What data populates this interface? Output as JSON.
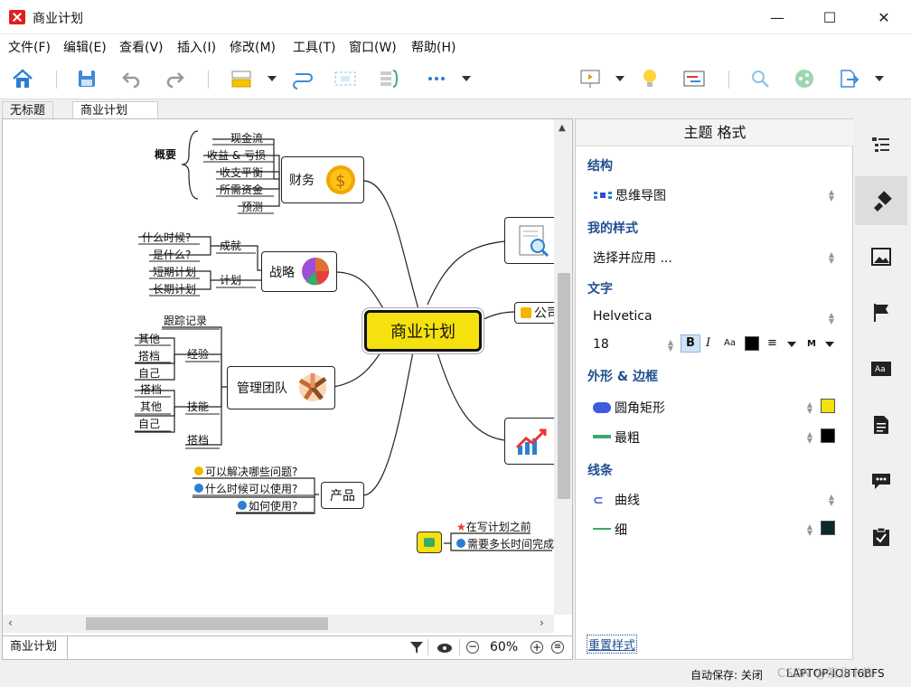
{
  "window": {
    "title": "商业计划",
    "minimize": "—",
    "maximize": "☐",
    "close": "✕"
  },
  "menu": [
    "文件(F)",
    "编辑(E)",
    "查看(V)",
    "插入(I)",
    "修改(M)",
    "工具(T)",
    "窗口(W)",
    "帮助(H)"
  ],
  "toolbar": {
    "icons": [
      "home-icon",
      "save-icon",
      "undo-icon",
      "redo-icon",
      "topic-icon",
      "relationship-icon",
      "boundary-icon",
      "summary-icon",
      "more-icon",
      "presentation-icon",
      "brainstorm-icon",
      "gantt-icon",
      "search-icon",
      "share-icon",
      "export-icon"
    ]
  },
  "tabs": [
    "无标题",
    "商业计划"
  ],
  "map": {
    "central": "商业计划",
    "finance": {
      "label": "财务",
      "summary": "概要",
      "items": [
        "现金流",
        "收益 & 亏损",
        "收支平衡",
        "所需资金",
        "预测"
      ]
    },
    "strategy": {
      "label": "战略",
      "achieve": "成就",
      "achieve_items": [
        "什么时候?",
        "是什么?"
      ],
      "plan": "计划",
      "plan_items": [
        "短期计划",
        "长期计划"
      ]
    },
    "team": {
      "label": "管理团队",
      "top": "跟踪记录",
      "exp": "经验",
      "exp_items": [
        "其他",
        "搭档",
        "自己"
      ],
      "skill": "技能",
      "skill_items": [
        "搭档",
        "其他",
        "自己"
      ],
      "bottom": "搭档"
    },
    "product": {
      "label": "产品",
      "items": [
        "可以解决哪些问题?",
        "什么时候可以使用?",
        "如何使用?"
      ]
    },
    "right_partial": {
      "company": "公司"
    },
    "floating": {
      "items": [
        "在写计划之前",
        "需要多长时间完成"
      ]
    }
  },
  "bottom_bar": {
    "sheet": "商业计划",
    "zoom": "60%"
  },
  "format_panel": {
    "title": "主题 格式",
    "structure_label": "结构",
    "structure_value": "思维导图",
    "mystyle_label": "我的样式",
    "mystyle_value": "选择并应用 ...",
    "text_label": "文字",
    "font": "Helvetica",
    "size": "18",
    "bold": "B",
    "italic": "I",
    "case": "Aa",
    "weight": "M",
    "shape_label": "外形 & 边框",
    "shape_value": "圆角矩形",
    "border_value": "最粗",
    "line_label": "线条",
    "line_value": "曲线",
    "line_width": "细",
    "reset": "重置样式",
    "colors": {
      "fill": "#f5e10d",
      "border": "#000000",
      "line": "#0a2a28"
    }
  },
  "status": {
    "autosave": "自动保存: 关闭",
    "machine": "LAPTOP-IO8T6BFS",
    "watermark": "CSDN @紫韭十依"
  },
  "colors": {
    "accent": "#1f4f91",
    "central_fill": "#f5e10d"
  }
}
